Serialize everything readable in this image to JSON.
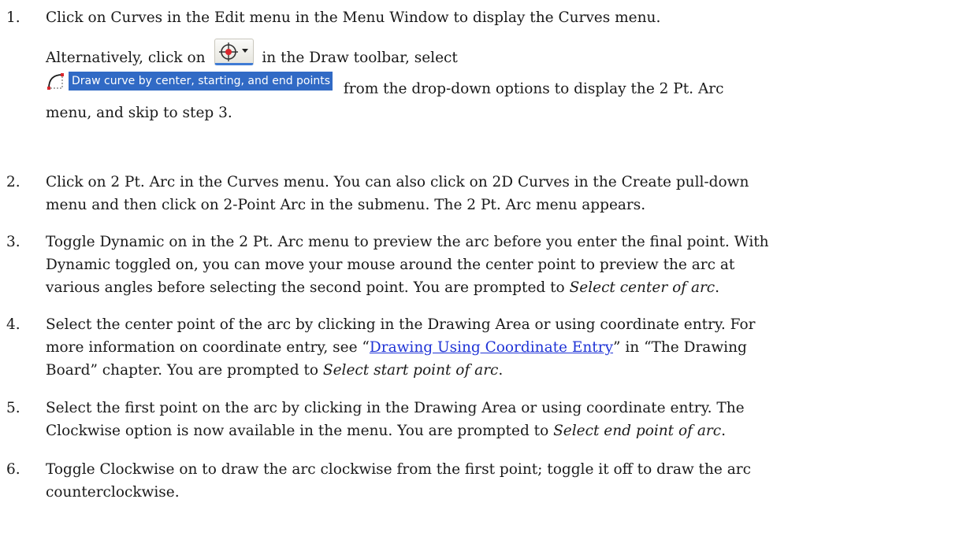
{
  "steps": [
    {
      "num": "1.",
      "line1": "Click on Curves in the Edit menu in the Menu Window to display the Curves menu.",
      "alt_prefix": "Alternatively, click on",
      "alt_suffix": "in the Draw toolbar, select",
      "menu_option_label": "Draw curve by center, starting, and end points",
      "after_option": "from the drop-down options to display the 2 Pt. Arc",
      "line_last": "menu, and skip to step 3."
    },
    {
      "num": "2.",
      "line1": "Click on 2 Pt. Arc in the Curves menu. You can also click on 2D Curves in the Create pull-down",
      "line2": "menu and then click on 2-Point Arc in the submenu. The 2 Pt. Arc menu appears."
    },
    {
      "num": "3.",
      "line1": "Toggle Dynamic on in the 2 Pt. Arc menu to preview the arc before you enter the final point. With",
      "line2": "Dynamic toggled on, you can move your mouse around the center point to preview the arc at",
      "line3_prefix": "various angles before selecting the second point. You are prompted to ",
      "line3_italic": "Select center of arc",
      "line3_suffix": "."
    },
    {
      "num": "4.",
      "line1": "Select the center point of the arc by clicking in the Drawing Area or using coordinate entry. For",
      "line2_prefix": "more information on coordinate entry, see “",
      "line2_link": "Drawing Using Coordinate Entry",
      "line2_suffix": "” in “The Drawing",
      "line3_prefix": "Board” chapter. You are prompted to ",
      "line3_italic": "Select start point of arc",
      "line3_suffix": "."
    },
    {
      "num": "5.",
      "line1": "Select the first point on the arc by clicking in the Drawing Area or using coordinate entry. The",
      "line2_prefix": "Clockwise option is now available in the menu. You are prompted to ",
      "line2_italic": "Select end point of arc",
      "line2_suffix": "."
    },
    {
      "num": "6.",
      "line1": "Toggle Clockwise on to draw the arc clockwise from the first point; toggle it off to draw the arc",
      "line2": "counterclockwise."
    }
  ],
  "icons": {
    "toolbar_button": "curves-dropdown-icon",
    "menu_option": "arc-center-start-end-icon"
  },
  "colors": {
    "link": "#1f33d6",
    "menu_highlight": "#316ac5"
  }
}
